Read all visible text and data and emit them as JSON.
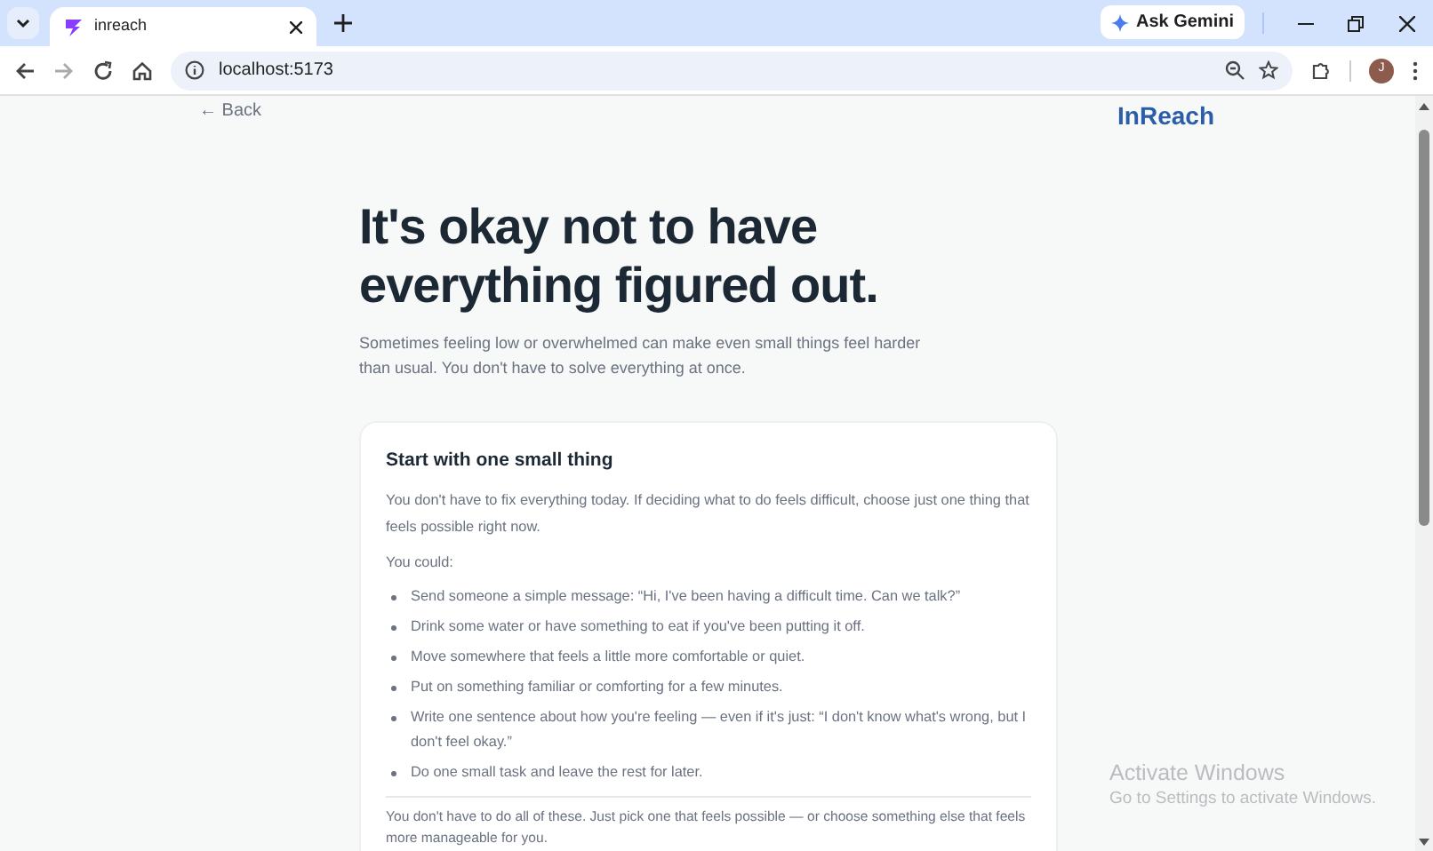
{
  "browser": {
    "tabs": [
      {
        "title": "inreach",
        "selected": true
      }
    ],
    "address": "localhost:5173",
    "gemini_button": "Ask Gemini",
    "profile_initial": "J"
  },
  "page": {
    "back_link": "← Back",
    "brand": "InReach",
    "heading": "It's okay not to have everything figured out.",
    "subtitle": "Sometimes feeling low or overwhelmed can make even small things feel harder than usual. You don't have to solve everything at once.",
    "card": {
      "title": "Start with one small thing",
      "intro": "You don't have to fix everything today. If deciding what to do feels difficult, choose just one thing that feels possible right now.",
      "lead": "You could:",
      "items": [
        "Send someone a simple message: “Hi, I've been having a difficult time. Can we talk?”",
        "Drink some water or have something to eat if you've been putting it off.",
        "Move somewhere that feels a little more comfortable or quiet.",
        "Put on something familiar or comforting for a few minutes.",
        "Write one sentence about how you're feeling — even if it's just: “I don't know what's wrong, but I don't feel okay.”",
        "Do one small task and leave the rest for later."
      ],
      "footer": "You don't have to do all of these. Just pick one that feels possible — or choose something else that feels more manageable for you."
    }
  },
  "system_notice": {
    "title": "Activate Windows",
    "message": "Go to Settings to activate Windows."
  }
}
